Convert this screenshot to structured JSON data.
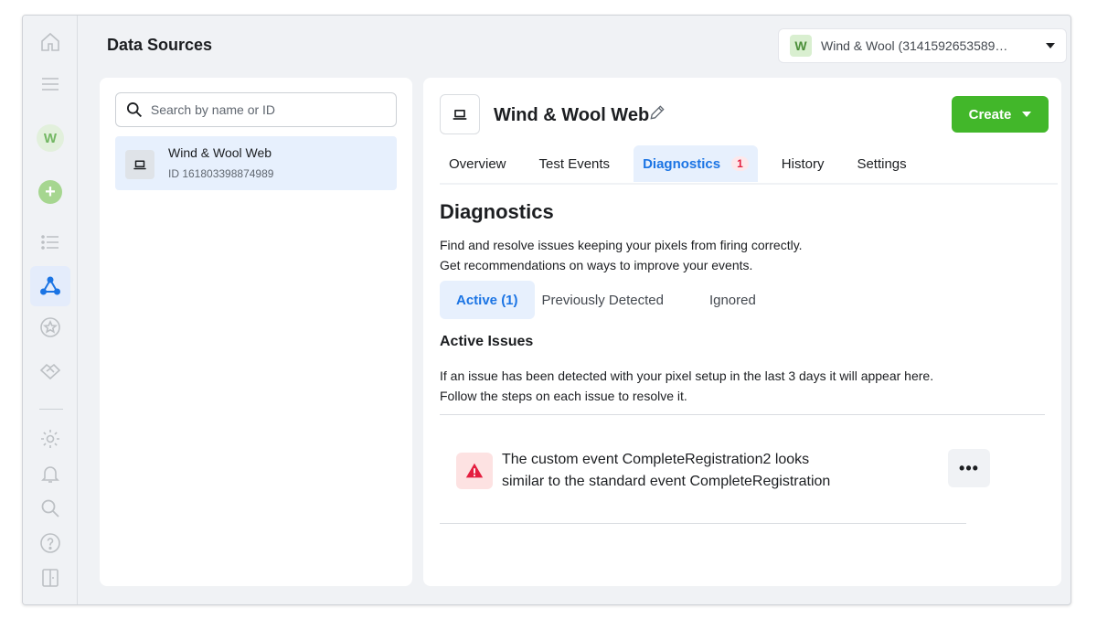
{
  "rail": {
    "icons": [
      "home-icon",
      "menu-icon",
      "account-avatar",
      "add-icon",
      "list-icon",
      "data-sources-icon",
      "star-icon",
      "handshake-icon",
      "settings-icon",
      "bell-icon",
      "search-icon",
      "help-icon",
      "panel-icon"
    ],
    "avatar_letter": "W",
    "add_symbol": "+"
  },
  "header": {
    "title": "Data Sources",
    "account_badge": "W",
    "account_name": "Wind & Wool (3141592653589…"
  },
  "sidebar": {
    "search_placeholder": "Search by name or ID",
    "items": [
      {
        "name": "Wind & Wool Web",
        "id": "ID 161803398874989"
      }
    ]
  },
  "main": {
    "asset_title": "Wind & Wool Web",
    "create_label": "Create",
    "tabs": [
      {
        "label": "Overview"
      },
      {
        "label": "Test Events"
      },
      {
        "label": "Diagnostics",
        "badge": "1"
      },
      {
        "label": "History"
      },
      {
        "label": "Settings"
      }
    ],
    "diagnostics": {
      "title": "Diagnostics",
      "desc_line1": "Find and resolve issues keeping your pixels from firing correctly.",
      "desc_line2": "Get recommendations on ways to improve your events.",
      "subtabs": [
        "Active (1)",
        "Previously Detected",
        "Ignored"
      ],
      "issues_title": "Active Issues",
      "issues_desc_line1": "If an issue has been detected with your pixel setup in the last 3 days it will appear here.",
      "issues_desc_line2": "Follow the steps on each issue to resolve it.",
      "issue_line1": "The custom event CompleteRegistration2 looks",
      "issue_line2": "similar to the standard event CompleteRegistration",
      "more_label": "•••"
    }
  },
  "colors": {
    "accent": "#1b74e4",
    "create_green": "#42b72a",
    "warning_red": "#e41e3f",
    "background": "#f0f2f5"
  }
}
